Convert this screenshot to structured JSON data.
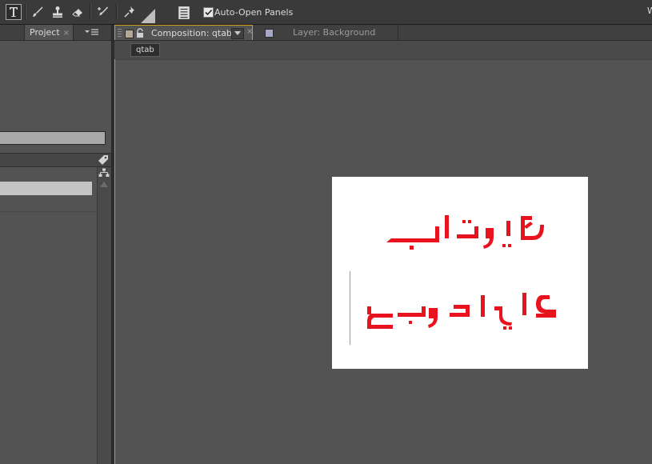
{
  "toolbar": {
    "tools": [
      "text-tool",
      "brush-tool",
      "clone-stamp-tool",
      "eraser-tool",
      "roto-brush-tool",
      "puppet-pin-tool"
    ],
    "auto_open_checked": true,
    "auto_open_label": "Auto-Open Panels",
    "workspace_partial": "W"
  },
  "project_panel": {
    "tab_label": "Project",
    "close_glyph": "×",
    "menu_icon": "panel-menu-icon"
  },
  "composition_panel": {
    "tab_label": "Composition: qtab",
    "close_glyph": "×",
    "layer_tab_label": "Layer: Background",
    "comp_button_label": "qtab",
    "comp_swatch_color": "#b5a894",
    "layer_swatch_color": "#a6a8c4",
    "active_border_color": "#d1a11e"
  },
  "canvas": {
    "background": "#ffffff",
    "text_color": "#e8131e"
  }
}
